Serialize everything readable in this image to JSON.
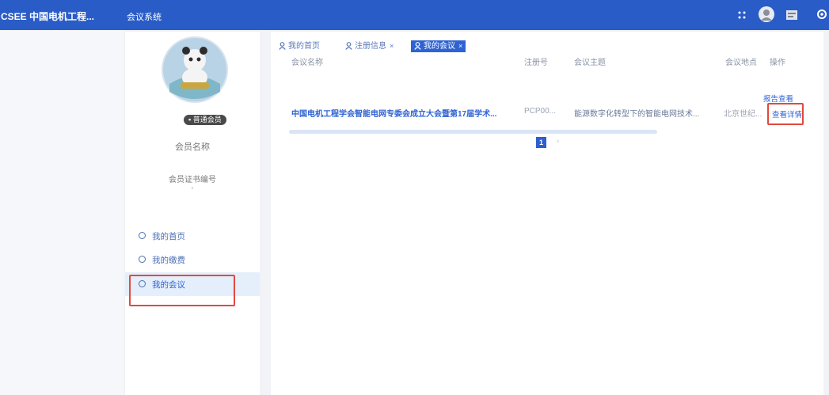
{
  "header": {
    "logo": "CSEE 中国电机工程...",
    "system": "会议系统",
    "icons": [
      "grid-icon",
      "user-avatar-icon",
      "message-icon",
      "settings-icon"
    ],
    "bg_color": "#2a5cc7"
  },
  "profile": {
    "badge": "普通会员",
    "name": "会员名称",
    "cert_label": "会员证书编号",
    "cert_value": "-"
  },
  "nav": [
    {
      "label": "我的首页",
      "icon": "circle-icon"
    },
    {
      "label": "我的缴费",
      "icon": "circle-icon"
    },
    {
      "label": "我的会议",
      "icon": "circle-icon",
      "active": true
    }
  ],
  "tabs": [
    {
      "label": "我的首页",
      "icon": "user-icon"
    },
    {
      "label": "注册信息",
      "icon": "user-icon",
      "close": "×"
    },
    {
      "label": "我的会议",
      "icon": "user-icon",
      "close": "×",
      "active": true
    }
  ],
  "table": {
    "headers": [
      "会议名称",
      "注册号",
      "会议主题",
      "会议地点",
      "操作"
    ],
    "rows": [
      {
        "name": "中国电机工程学会智能电网专委会成立大会暨第17届学术...",
        "reg": "PCP00...",
        "topic": "能源数字化转型下的智能电网技术...",
        "place": "北京世纪...",
        "actions": [
          "报告查看",
          "查看详情"
        ]
      }
    ]
  },
  "pagination": {
    "current": "1",
    "next": "›"
  },
  "colors": {
    "accent": "#2f63d3",
    "annotation": "#e04a3f"
  }
}
